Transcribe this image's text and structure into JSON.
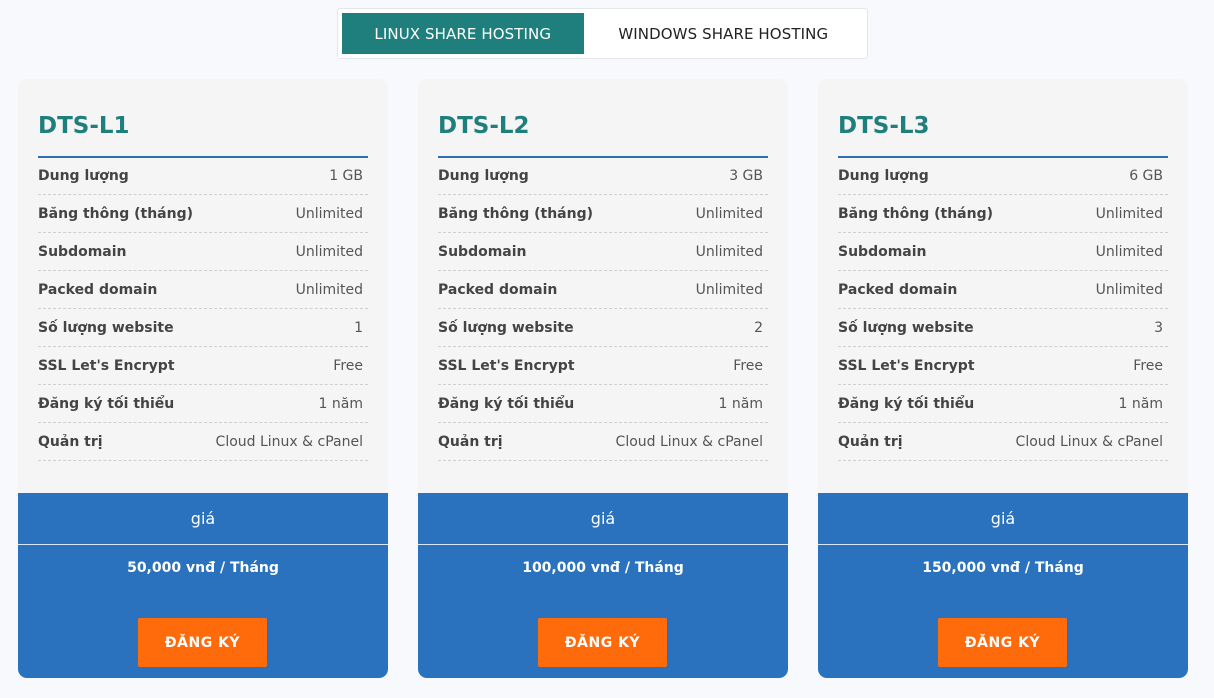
{
  "tabs": [
    {
      "label": "LINUX SHARE HOSTING",
      "active": true
    },
    {
      "label": "WINDOWS SHARE HOSTING",
      "active": false
    }
  ],
  "colors": {
    "accent_teal": "#1f7f7d",
    "price_blue": "#2a72bd",
    "button_orange": "#ff6b0b",
    "card_bg": "#f5f5f5"
  },
  "plans": [
    {
      "title": "DTS-L1",
      "specs": [
        {
          "label": "Dung lượng",
          "value": "1 GB"
        },
        {
          "label": "Băng thông (tháng)",
          "value": "Unlimited"
        },
        {
          "label": "Subdomain",
          "value": "Unlimited"
        },
        {
          "label": "Packed domain",
          "value": "Unlimited"
        },
        {
          "label": "Số lượng website",
          "value": "1"
        },
        {
          "label": "SSL Let's Encrypt",
          "value": "Free"
        },
        {
          "label": "Đăng ký tối thiểu",
          "value": "1 năm"
        },
        {
          "label": "Quản trị",
          "value": "Cloud Linux & cPanel"
        }
      ],
      "price_heading": "giá",
      "price": "50,000 vnđ / Tháng",
      "button_label": "ĐĂNG KÝ"
    },
    {
      "title": "DTS-L2",
      "specs": [
        {
          "label": "Dung lượng",
          "value": "3 GB"
        },
        {
          "label": "Băng thông (tháng)",
          "value": "Unlimited"
        },
        {
          "label": "Subdomain",
          "value": "Unlimited"
        },
        {
          "label": "Packed domain",
          "value": "Unlimited"
        },
        {
          "label": "Số lượng website",
          "value": "2"
        },
        {
          "label": "SSL Let's Encrypt",
          "value": "Free"
        },
        {
          "label": "Đăng ký tối thiểu",
          "value": "1 năm"
        },
        {
          "label": "Quản trị",
          "value": "Cloud Linux & cPanel"
        }
      ],
      "price_heading": "giá",
      "price": "100,000 vnđ / Tháng",
      "button_label": "ĐĂNG KÝ"
    },
    {
      "title": "DTS-L3",
      "specs": [
        {
          "label": "Dung lượng",
          "value": "6 GB"
        },
        {
          "label": "Băng thông (tháng)",
          "value": "Unlimited"
        },
        {
          "label": "Subdomain",
          "value": "Unlimited"
        },
        {
          "label": "Packed domain",
          "value": "Unlimited"
        },
        {
          "label": "Số lượng website",
          "value": "3"
        },
        {
          "label": "SSL Let's Encrypt",
          "value": "Free"
        },
        {
          "label": "Đăng ký tối thiểu",
          "value": "1 năm"
        },
        {
          "label": "Quản trị",
          "value": "Cloud Linux & cPanel"
        }
      ],
      "price_heading": "giá",
      "price": "150,000 vnđ / Tháng",
      "button_label": "ĐĂNG KÝ"
    }
  ]
}
